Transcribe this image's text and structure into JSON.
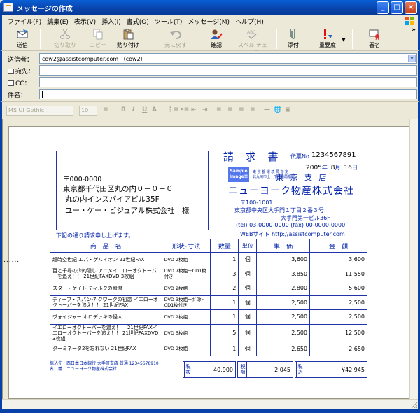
{
  "window": {
    "title": "メッセージの作成",
    "min_label": "_",
    "max_label": "□",
    "close_label": "×"
  },
  "menu": [
    "ファイル(F)",
    "編集(E)",
    "表示(V)",
    "挿入(I)",
    "書式(O)",
    "ツール(T)",
    "メッセージ(M)",
    "ヘルプ(H)"
  ],
  "toolbar": {
    "send": "送信",
    "cut": "切り取り",
    "copy": "コピー",
    "paste": "貼り付け",
    "undo": "元に戻す",
    "check": "確認",
    "spell": "スペル チェック",
    "attach": "添付",
    "priority": "重要度",
    "sign": "署名",
    "more": "»"
  },
  "header": {
    "from_label": "送信者：",
    "from_value": "cow2@assistcomputer.com （cow2）",
    "to_label": "宛先：",
    "cc_label": "CC：",
    "subject_label": "件名："
  },
  "format": {
    "font": "MS UI Gothic",
    "size": "10",
    "bold": "B",
    "italic": "I",
    "underline": "U",
    "color": "A"
  },
  "invoice": {
    "addr_zip": "〒000-0000",
    "addr_line1": "東京都千代田区丸の内０－０－０",
    "addr_line2": "丸の内インスパイアビル35F",
    "addr_line3": "ユー・ケー・ビジュアル株式会社　様",
    "note": "下記の通り請求申し上げます。",
    "dots": "......",
    "title": "請 求 書",
    "no_label": "伝票No",
    "no_value": "1234567891",
    "date_year": "2005",
    "date_year_unit": "年",
    "date_month": "8",
    "date_month_unit": "月",
    "date_day": "16",
    "date_day_unit": "日",
    "sample_line1": "Sample",
    "sample_line2": "Image!!",
    "stamp_line1": "東 京 都 環 境 局 指 定",
    "stamp_line2": "北九州市上・下水道局指定",
    "branch": "東 京 支 店",
    "company": "ニューヨーク物産株式会社",
    "company_zip": "〒100-1001",
    "company_addr1": "東京都中央区大手門１丁目２番３号",
    "company_addr2": "大手門第一ビル36F",
    "company_tel": "(tel) 03-0000-0000  (fax) 00-0000-0000",
    "company_web": "WEBサイト http://assistcomputer.com",
    "headers": [
      "商　品　名",
      "形状･寸法",
      "数量",
      "単位",
      "単　価",
      "金　額"
    ],
    "rows": [
      {
        "name": "超時空世紀 エバ・ゲルイオン 21世紀FAX",
        "spec": "DVD 2枚組",
        "qty": "1",
        "unit": "個",
        "price": "3,600",
        "amount": "3,600"
      },
      {
        "name": "百と千尋の少的隠し アニメイエローオクトーバーを追え！！ 21世紀FAXDVD 3枚組",
        "spec": "DVD 7枚組＋CD1枚付き",
        "qty": "3",
        "unit": "個",
        "price": "3,850",
        "amount": "11,550"
      },
      {
        "name": "スター・ケイト ティルクの瞬間",
        "spec": "DVD 2枚組",
        "qty": "2",
        "unit": "個",
        "price": "2,800",
        "amount": "5,600"
      },
      {
        "name": "ディープ・スパン-7 クワークの初恋 イエローオクトーバーを追え！！ 21世紀FAX",
        "spec": "DVD 3枚組＋ﾎﾟｽﾀｰCD1枚付き",
        "qty": "1",
        "unit": "個",
        "price": "2,500",
        "amount": "2,500"
      },
      {
        "name": "ヴォイジャー ホロデッキの怪人",
        "spec": "DVD 2枚組",
        "qty": "1",
        "unit": "個",
        "price": "2,500",
        "amount": "2,500"
      },
      {
        "name": "イエローオクトーバーを追え！！ 21世紀FAXイエローオクトーバーを追え！！ 21世紀FAXDVD 3枚組",
        "spec": "DVD 5枚組",
        "qty": "5",
        "unit": "個",
        "price": "2,500",
        "amount": "12,500"
      },
      {
        "name": "ターミネータ2を忘れない 21世紀FAX",
        "spec": "DVD 2枚組",
        "qty": "1",
        "unit": "個",
        "price": "2,650",
        "amount": "2,650"
      }
    ],
    "bank_line1": "振込先　西日本日本銀行 大手町支店 普通 12345678910",
    "bank_line2": "名　義　ニューヨーク物産株式会社",
    "subtotal_label": "税抜",
    "subtotal": "40,900",
    "tax_label": "税額",
    "tax": "2,045",
    "total_label": "税込",
    "total": "¥42,945"
  },
  "colors": {
    "titlebar": "#0842a8",
    "invoice_blue": "#0022aa"
  }
}
